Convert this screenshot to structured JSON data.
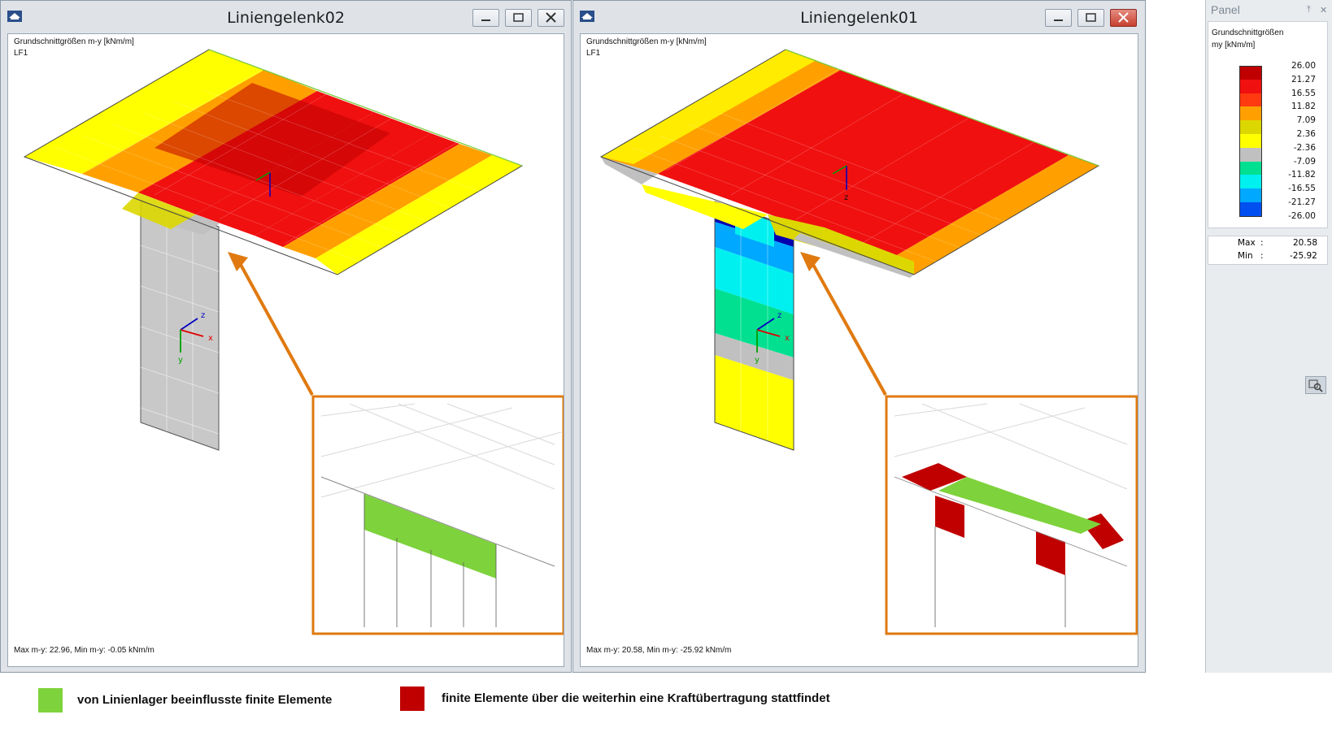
{
  "left_window": {
    "title": "Liniengelenk02",
    "info_line1": "Grundschnittgrößen m-y [kNm/m]",
    "info_line2": "LF1",
    "footer": "Max m-y: 22.96, Min m-y: -0.05 kNm/m"
  },
  "right_window": {
    "title": "Liniengelenk01",
    "info_line1": "Grundschnittgrößen m-y [kNm/m]",
    "info_line2": "LF1",
    "footer": "Max m-y: 20.58, Min m-y: -25.92 kNm/m"
  },
  "axis_labels": {
    "z": "z",
    "x": "x",
    "y": "y"
  },
  "panel": {
    "title": "Panel",
    "heading1": "Grundschnittgrößen",
    "heading2": "my [kNm/m]",
    "legend": [
      {
        "value": "26.00",
        "color": "#c00000"
      },
      {
        "value": "21.27",
        "color": "#f01010"
      },
      {
        "value": "16.55",
        "color": "#ff3a10"
      },
      {
        "value": "11.82",
        "color": "#ffa000"
      },
      {
        "value": "7.09",
        "color": "#dcd700"
      },
      {
        "value": "2.36",
        "color": "#ffff00"
      },
      {
        "value": "-2.36",
        "color": "#c0c0c0"
      },
      {
        "value": "-7.09",
        "color": "#00e090"
      },
      {
        "value": "-11.82",
        "color": "#00f0f0"
      },
      {
        "value": "-16.55",
        "color": "#00a8ff"
      },
      {
        "value": "-21.27",
        "color": "#0050f0"
      },
      {
        "value": "-26.00",
        "color": "#0000b0"
      }
    ],
    "max_label": "Max",
    "max_value": "20.58",
    "min_label": "Min",
    "min_value": "-25.92",
    "colon": ":"
  },
  "bottom_legend": {
    "green_label": "von Linienlager beeinflusste finite Elemente",
    "green_color": "#7ed23c",
    "red_label": "finite Elemente über die weiterhin eine Kraftübertragung stattfindet",
    "red_color": "#c00000"
  },
  "accent_color": "#e07a10"
}
